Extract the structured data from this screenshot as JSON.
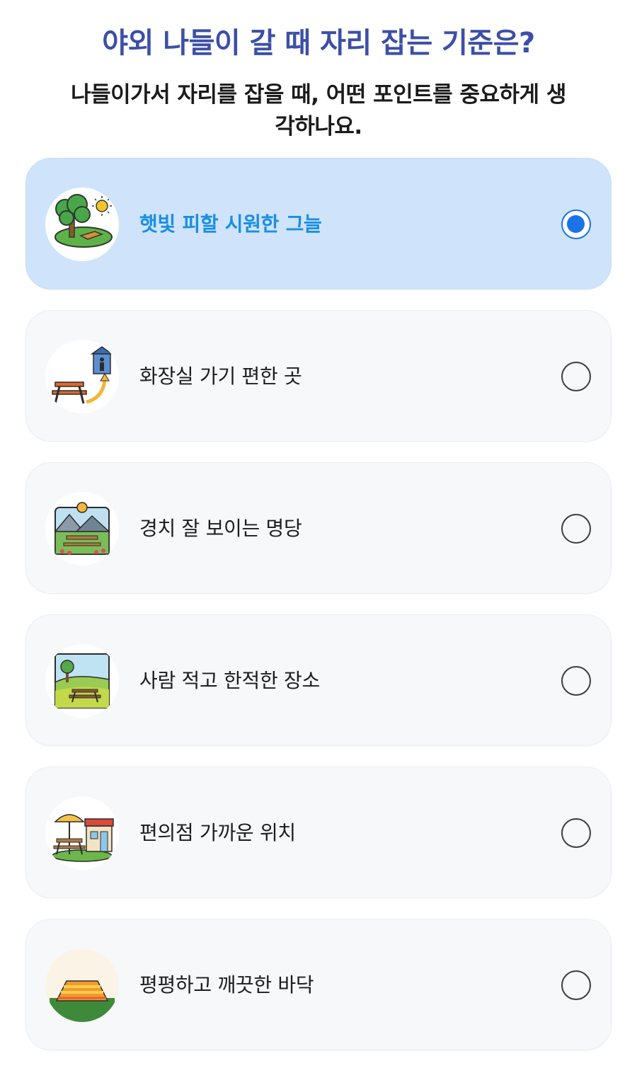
{
  "survey": {
    "title": "야외 나들이 갈 때 자리 잡는 기준은?",
    "subtitle": "나들이가서 자리를 잡을 때, 어떤 포인트를 중요하게 생각하나요.",
    "options": [
      {
        "label": "햇빛 피할 시원한 그늘",
        "icon": "tree-shade-icon",
        "selected": true
      },
      {
        "label": "화장실 가기 편한 곳",
        "icon": "restroom-path-icon",
        "selected": false
      },
      {
        "label": "경치 잘 보이는 명당",
        "icon": "scenic-view-icon",
        "selected": false
      },
      {
        "label": "사람 적고 한적한 장소",
        "icon": "quiet-field-icon",
        "selected": false
      },
      {
        "label": "편의점 가까운 위치",
        "icon": "convenience-store-icon",
        "selected": false
      },
      {
        "label": "평평하고 깨끗한 바닥",
        "icon": "flat-mat-icon",
        "selected": false
      }
    ]
  },
  "colors": {
    "title": "#3c4fa8",
    "selected_background": "#cfe3fb",
    "selected_text": "#1a8fe0",
    "radio_selected": "#1a73e8"
  }
}
